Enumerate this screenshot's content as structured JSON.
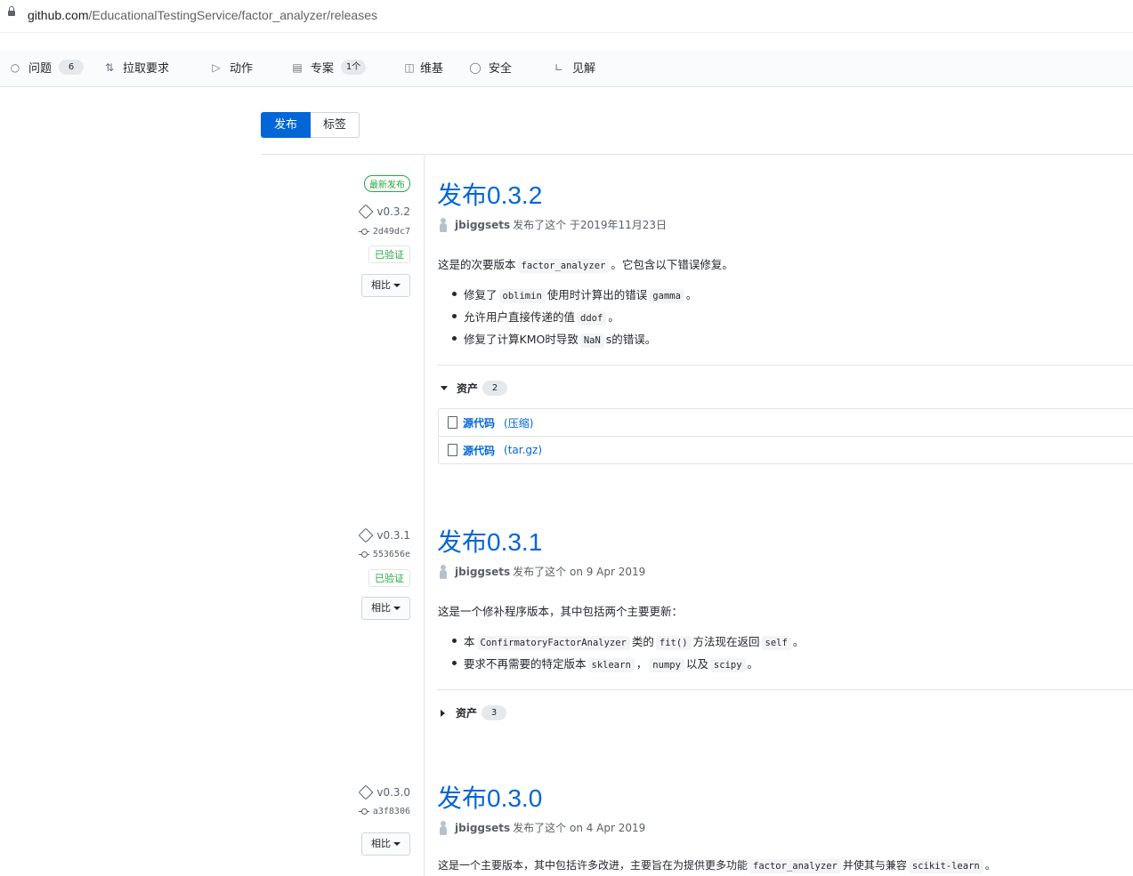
{
  "browser": {
    "url_host": "github.com",
    "url_path": "/EducationalTestingService/factor_analyzer/releases"
  },
  "repo_nav": {
    "issues": {
      "label": "问题",
      "count": "6",
      "icon": "issue-opened-icon"
    },
    "pulls": {
      "label": "拉取要求",
      "icon": "git-pull-request-icon"
    },
    "actions": {
      "label": "动作",
      "icon": "play-icon"
    },
    "projects": {
      "label": "专案",
      "count": "1个",
      "icon": "project-icon"
    },
    "wiki": {
      "label": "维基",
      "icon": "book-icon"
    },
    "security": {
      "label": "安全",
      "icon": "shield-icon"
    },
    "insights": {
      "label": "见解",
      "icon": "graph-icon"
    }
  },
  "tabs": {
    "releases": "发布",
    "tags": "标签"
  },
  "releases": [
    {
      "latest_badge": "最新发布",
      "tag": "v0.3.2",
      "commit": "2d49dc7",
      "verified": "已验证",
      "compare": "相比",
      "title": "发布0.3.2",
      "author": "jbiggsets",
      "published": "发布了这个 于2019年11月23日",
      "intro_a": "这是的次要版本",
      "intro_code": "factor_analyzer",
      "intro_b": "。它包含以下错误修复。",
      "bullets": [
        {
          "a": "修复了",
          "c1": "oblimin",
          "b": "使用时计算出的错误",
          "c2": "gamma",
          "d": "。"
        },
        {
          "a": "允许用户直接传递的值",
          "c1": "ddof",
          "b": "。"
        },
        {
          "a": "修复了计算KMO时导致",
          "c1": "NaN",
          "b": "s的错误。"
        }
      ],
      "assets_label": "资产",
      "assets_count": "2",
      "assets": [
        {
          "name": "源代码",
          "format": "(压缩)"
        },
        {
          "name": "源代码",
          "format": "(tar.gz)"
        }
      ]
    },
    {
      "tag": "v0.3.1",
      "commit": "553656e",
      "verified": "已验证",
      "compare": "相比",
      "title": "发布0.3.1",
      "author": "jbiggsets",
      "published": "发布了这个 on 9 Apr 2019",
      "intro": "这是一个修补程序版本，其中包括两个主要更新：",
      "bullets": [
        {
          "a": "本",
          "c1": "ConfirmatoryFactorAnalyzer",
          "b": "类的",
          "c2": "fit()",
          "d": "方法现在返回",
          "c3": "self",
          "e": "。"
        },
        {
          "a": "要求不再需要的特定版本",
          "c1": "sklearn",
          "b": "，",
          "c2": "numpy",
          "d": "以及",
          "c3": "scipy",
          "e": "。"
        }
      ],
      "assets_label": "资产",
      "assets_count": "3"
    },
    {
      "tag": "v0.3.0",
      "commit": "a3f8306",
      "compare": "相比",
      "title": "发布0.3.0",
      "author": "jbiggsets",
      "published": "发布了这个 on 4 Apr 2019",
      "intro_a": "这是一个主要版本，其中包括许多改进，主要旨在为提供更多功能",
      "intro_code": "factor_analyzer",
      "intro_b": "并使其与兼容",
      "intro_code2": "scikit-learn",
      "intro_c": "。"
    }
  ]
}
